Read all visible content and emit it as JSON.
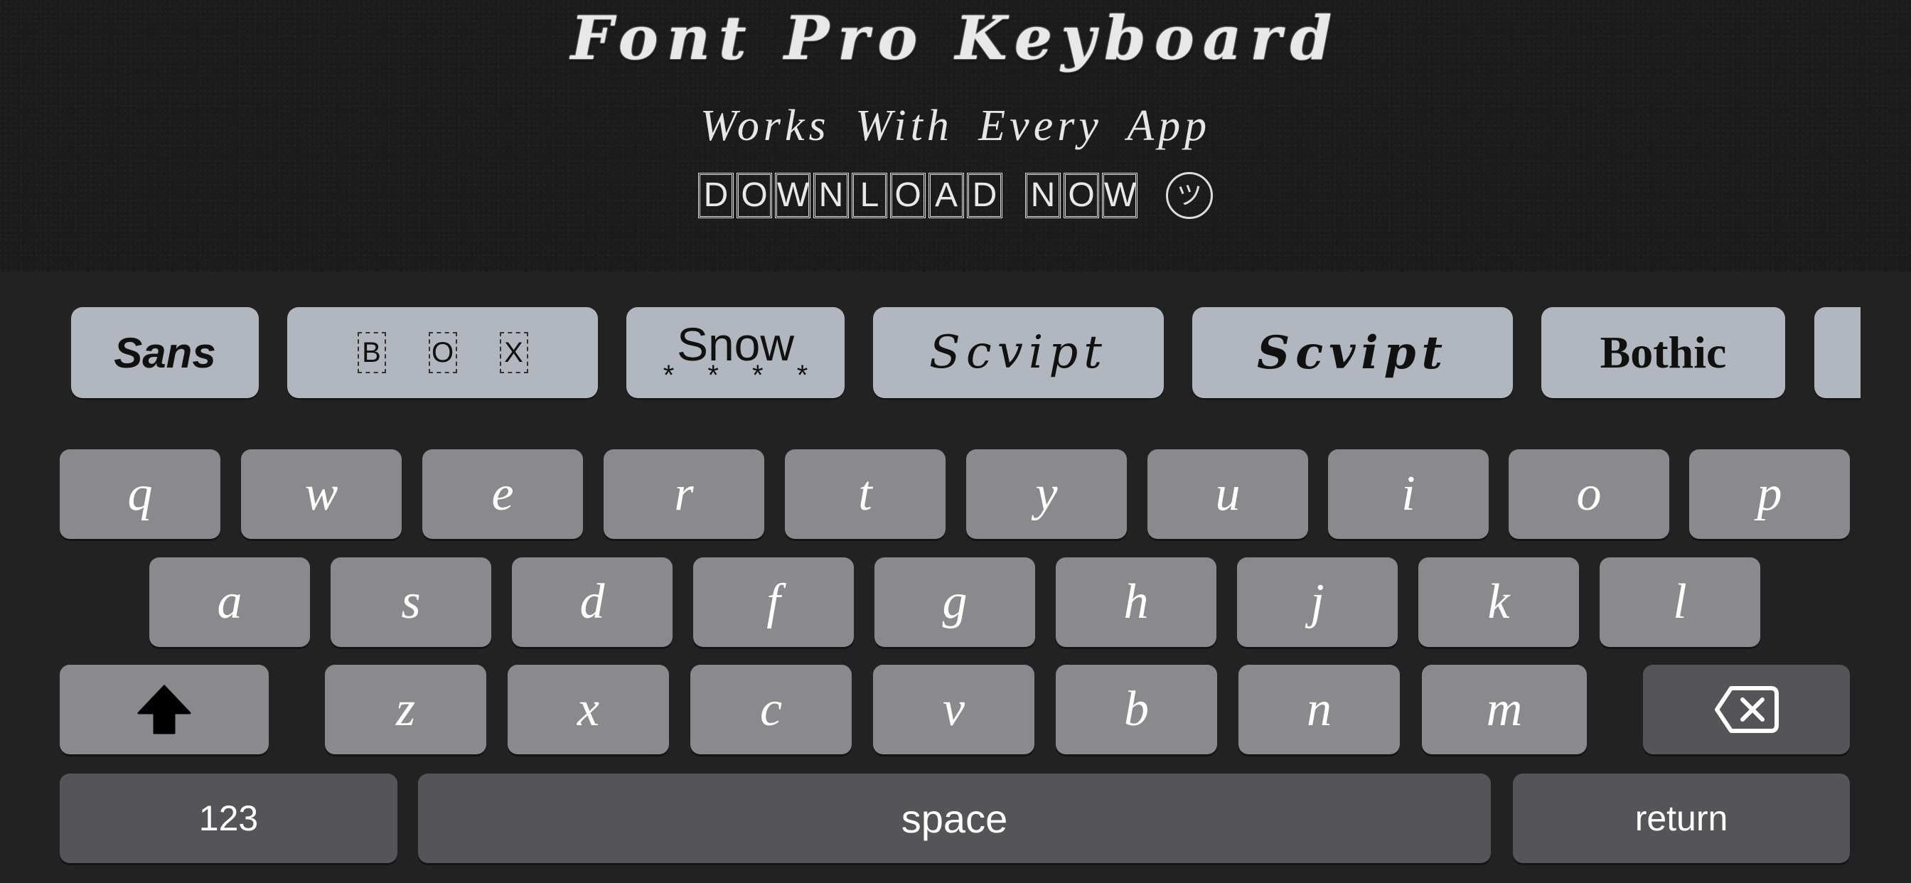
{
  "header": {
    "title": "Font Pro Keyboard",
    "subtitle": "Works With Every App",
    "cta_words": [
      [
        "D",
        "O",
        "W",
        "N",
        "L",
        "O",
        "A",
        "D"
      ],
      [
        "N",
        "O",
        "W"
      ]
    ],
    "cta_text": "DOWNLOAD NOW",
    "cta_emoji": "ツ"
  },
  "font_bar": {
    "items": [
      {
        "label": "Sans",
        "style": "sans"
      },
      {
        "label": "BOX",
        "letters": [
          "B",
          "O",
          "X"
        ],
        "style": "box"
      },
      {
        "label": "Snow",
        "decoration": "* * * *",
        "style": "snow"
      },
      {
        "label": "Scvipt",
        "style": "script-light"
      },
      {
        "label": "Scvipt",
        "style": "script-bold"
      },
      {
        "label": "Bothic",
        "style": "gothic"
      },
      {
        "label": "",
        "style": "partial"
      }
    ]
  },
  "keyboard": {
    "row1": [
      "q",
      "w",
      "e",
      "r",
      "t",
      "y",
      "u",
      "i",
      "o",
      "p"
    ],
    "row2": [
      "a",
      "s",
      "d",
      "f",
      "g",
      "h",
      "j",
      "k",
      "l"
    ],
    "row3": [
      "z",
      "x",
      "c",
      "v",
      "b",
      "n",
      "m"
    ],
    "shift_icon": "shift-arrow-up",
    "delete_icon": "backspace-x",
    "numbers_label": "123",
    "space_label": "space",
    "return_label": "return"
  },
  "colors": {
    "header_bg": "#1b1b1b",
    "keyboard_bg": "#222222",
    "chip_bg": "#b2b7bf",
    "letter_key": "#8a8a8c",
    "function_key": "#555557",
    "key_text": "#ffffff"
  }
}
